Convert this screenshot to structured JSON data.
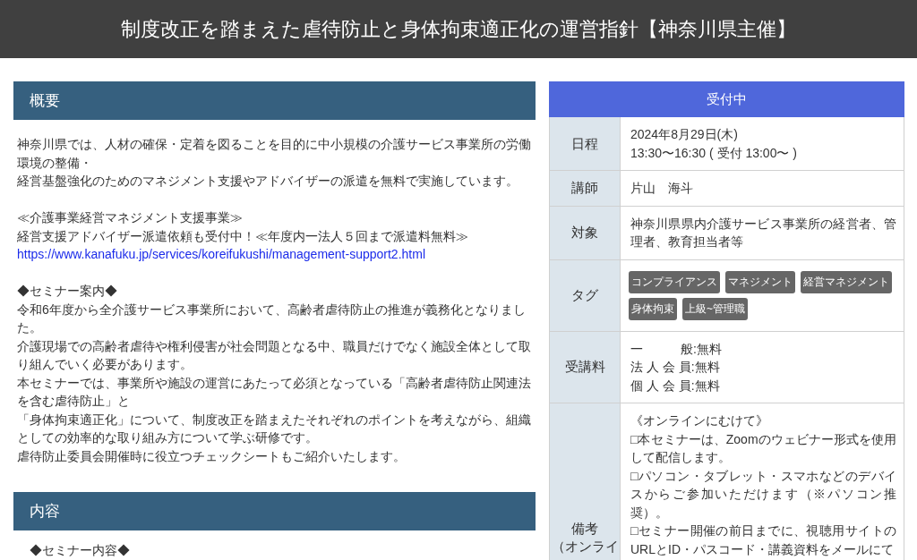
{
  "header": {
    "title": "制度改正を踏まえた虐待防止と身体拘束適正化の運営指針【神奈川県主催】"
  },
  "sections": [
    {
      "heading": "概要",
      "blocks": [
        [
          {
            "kind": "text",
            "text": "神奈川県では、人材の確保・定着を図ることを目的に中小規模の介護サービス事業所の労働環境の整備・"
          },
          {
            "kind": "text",
            "text": "経営基盤強化のためのマネジメント支援やアドバイザーの派遣を無料で実施しています。"
          }
        ],
        [
          {
            "kind": "text",
            "text": "≪介護事業経営マネジメント支援事業≫"
          },
          {
            "kind": "text",
            "text": "経営支援アドバイザー派遣依頼も受付中！≪年度内一法人５回まで派遣料無料≫"
          },
          {
            "kind": "link",
            "text": "https://www.kanafuku.jp/services/koreifukushi/management-support2.html"
          }
        ],
        [
          {
            "kind": "text",
            "text": "◆セミナー案内◆"
          },
          {
            "kind": "text",
            "text": "令和6年度から全介護サービス事業所において、高齢者虐待防止の推進が義務化となりました。"
          },
          {
            "kind": "text",
            "text": "介護現場での高齢者虐待や権利侵害が社会問題となる中、職員だけでなく施設全体として取り組んでいく必要があります。"
          },
          {
            "kind": "text",
            "text": "本セミナーでは、事業所や施設の運営にあたって必須となっている「高齢者虐待防止関連法を含む虐待防止」と"
          },
          {
            "kind": "text",
            "text": "「身体拘束適正化」について、制度改正を踏まえたそれぞれのポイントを考えながら、組織としての効率的な取り組み方について学ぶ研修です。"
          },
          {
            "kind": "text",
            "text": "虐待防止委員会開催時に役立つチェックシートもご紹介いたします。"
          }
        ]
      ]
    },
    {
      "heading": "内容",
      "blocks": [
        [
          {
            "kind": "text",
            "text": "◆セミナー内容◆"
          }
        ]
      ]
    }
  ],
  "status": {
    "label": "受付中"
  },
  "details": [
    {
      "label": [
        "日程"
      ],
      "kind": "lines",
      "lines": [
        "2024年8月29日(木)",
        "13:30〜16:30 ( 受付 13:00〜 )"
      ]
    },
    {
      "label": [
        "講師"
      ],
      "kind": "lines",
      "lines": [
        "片山　海斗"
      ]
    },
    {
      "label": [
        "対象"
      ],
      "kind": "lines",
      "lines": [
        "神奈川県県内介護サービス事業所の経営者、管理者、教育担当者等"
      ]
    },
    {
      "label": [
        "タグ"
      ],
      "kind": "tags",
      "tags": [
        "コンプライアンス",
        "マネジメント",
        "経営マネジメント",
        "身体拘束",
        "上級~管理職"
      ]
    },
    {
      "label": [
        "受講料"
      ],
      "kind": "lines",
      "lines": [
        "一　　　般:無料",
        "法 人 会 員:無料",
        "個 人 会 員:無料"
      ]
    },
    {
      "label": [
        "備考",
        "（オンライ"
      ],
      "kind": "lines",
      "lines": [
        "《オンラインにむけて》",
        "□本セミナーは、Zoomのウェビナー形式を使用して配信します。",
        "□パソコン・タブレット・スマホなどのデバイスからご参加いただけます（※パソコン推奨）。",
        "□セミナー開催の前日までに、視聴用サイトのURLとID・パスコード・講義資料をメールにて"
      ]
    }
  ]
}
